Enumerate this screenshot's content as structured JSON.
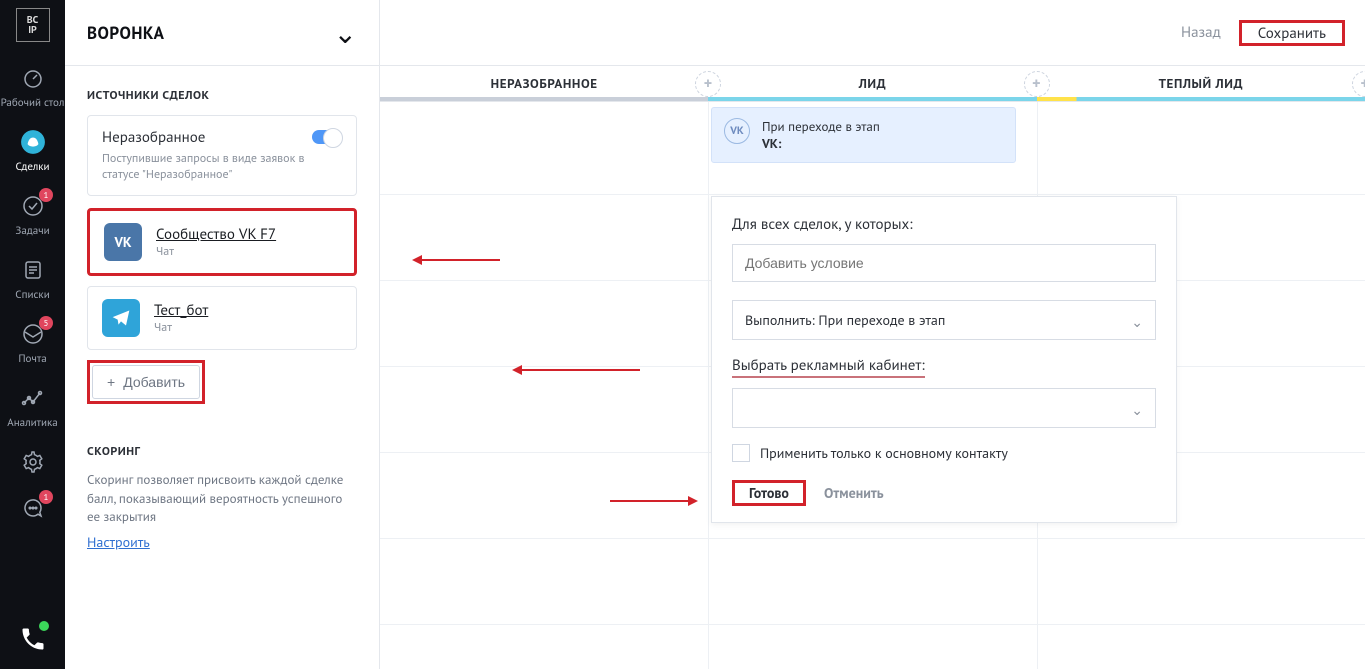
{
  "rail": {
    "logo_top": "BC",
    "logo_bot": "IP",
    "items": [
      {
        "icon": "dashboard-icon",
        "label": "Рабочий стол",
        "badge": null,
        "active": false
      },
      {
        "icon": "deals-icon",
        "label": "Сделки",
        "badge": null,
        "active": true
      },
      {
        "icon": "tasks-icon",
        "label": "Задачи",
        "badge": "1",
        "active": false
      },
      {
        "icon": "lists-icon",
        "label": "Списки",
        "badge": null,
        "active": false
      },
      {
        "icon": "mail-icon",
        "label": "Почта",
        "badge": "5",
        "active": false
      },
      {
        "icon": "analytics-icon",
        "label": "Аналитика",
        "badge": null,
        "active": false
      },
      {
        "icon": "settings-icon",
        "label": "",
        "badge": null,
        "active": false
      },
      {
        "icon": "chat-icon",
        "label": "",
        "badge": "1",
        "active": false
      }
    ]
  },
  "panel": {
    "title": "ВОРОНКА",
    "sources": {
      "section_title": "ИСТОЧНИКИ СДЕЛОК",
      "unsorted": {
        "name": "Неразобранное",
        "desc": "Поступившие запросы в виде заявок в статусе \"Неразобранное\""
      },
      "items": [
        {
          "name": "Сообщество VK F7",
          "type": "Чат",
          "icon": "vk"
        },
        {
          "name": "Тест_бот",
          "type": "Чат",
          "icon": "tg"
        }
      ],
      "add_label": "Добавить"
    },
    "scoring": {
      "title": "СКОРИНГ",
      "desc": "Скоринг позволяет присвоить каждой сделке балл, показывающий вероятность успешного ее закрытия",
      "link": "Настроить"
    }
  },
  "topbar": {
    "back": "Назад",
    "save": "Сохранить"
  },
  "stages": [
    "НЕРАЗОБРАННОЕ",
    "ЛИД",
    "ТЕПЛЫЙ ЛИД"
  ],
  "trigger": {
    "line1": "При переходе в этап",
    "line2": "VK:"
  },
  "popup": {
    "for_all_label": "Для всех сделок, у которых:",
    "cond_placeholder": "Добавить условие",
    "exec_select": "Выполнить: При переходе в этап",
    "ad_cabinet_label": "Выбрать рекламный кабинет:",
    "apply_main_contact": "Применить только к основному контакту",
    "done": "Готово",
    "cancel": "Отменить"
  }
}
